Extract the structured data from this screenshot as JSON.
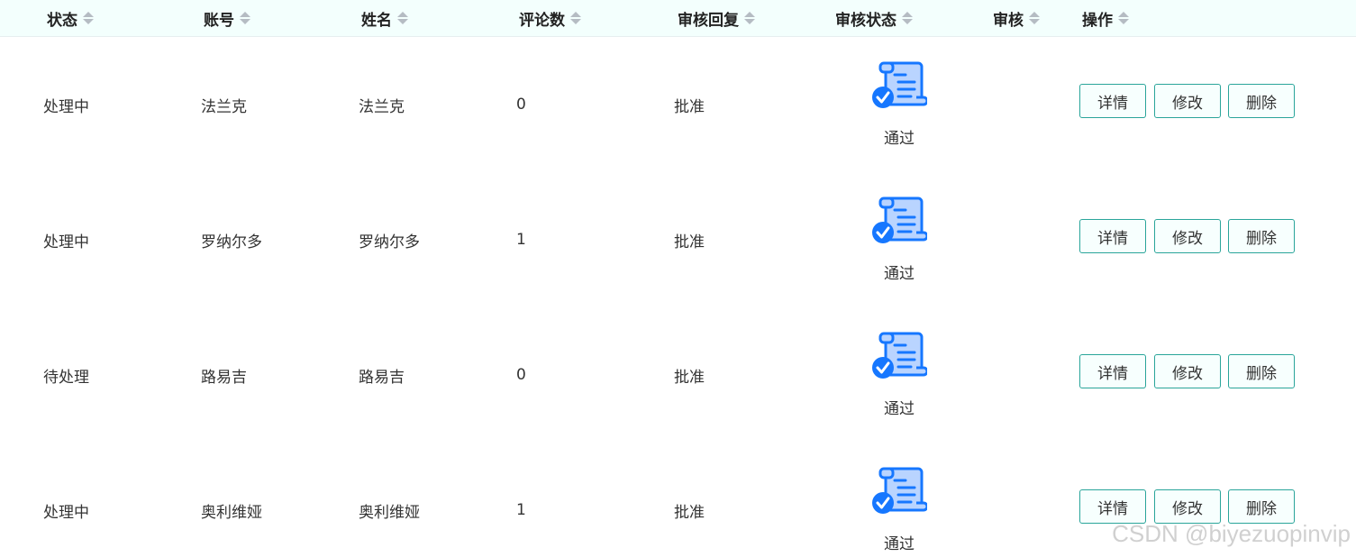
{
  "header": {
    "columns": [
      {
        "label": "状态",
        "sortable": true
      },
      {
        "label": "账号",
        "sortable": true
      },
      {
        "label": "姓名",
        "sortable": true
      },
      {
        "label": "评论数",
        "sortable": true
      },
      {
        "label": "审核回复",
        "sortable": true
      },
      {
        "label": "审核状态",
        "sortable": true
      },
      {
        "label": "审核",
        "sortable": true
      },
      {
        "label": "操作",
        "sortable": true
      }
    ]
  },
  "rows": [
    {
      "status": "处理中",
      "account": "法兰克",
      "name": "法兰克",
      "comments": "0",
      "reply": "批准",
      "audit_state": "通过",
      "audit_icon": "document-approved-icon"
    },
    {
      "status": "处理中",
      "account": "罗纳尔多",
      "name": "罗纳尔多",
      "comments": "1",
      "reply": "批准",
      "audit_state": "通过",
      "audit_icon": "document-approved-icon"
    },
    {
      "status": "待处理",
      "account": "路易吉",
      "name": "路易吉",
      "comments": "0",
      "reply": "批准",
      "audit_state": "通过",
      "audit_icon": "document-approved-icon"
    },
    {
      "status": "处理中",
      "account": "奥利维娅",
      "name": "奥利维娅",
      "comments": "1",
      "reply": "批准",
      "audit_state": "通过",
      "audit_icon": "document-approved-icon"
    }
  ],
  "actions": {
    "details_label": "详情",
    "edit_label": "修改",
    "delete_label": "删除"
  },
  "colors": {
    "header_bg": "#f3fffd",
    "button_border": "#2aa59a",
    "icon_blue": "#1677ff",
    "icon_light_blue": "#b9d4ff"
  },
  "watermark": "CSDN @biyezuopinvip"
}
